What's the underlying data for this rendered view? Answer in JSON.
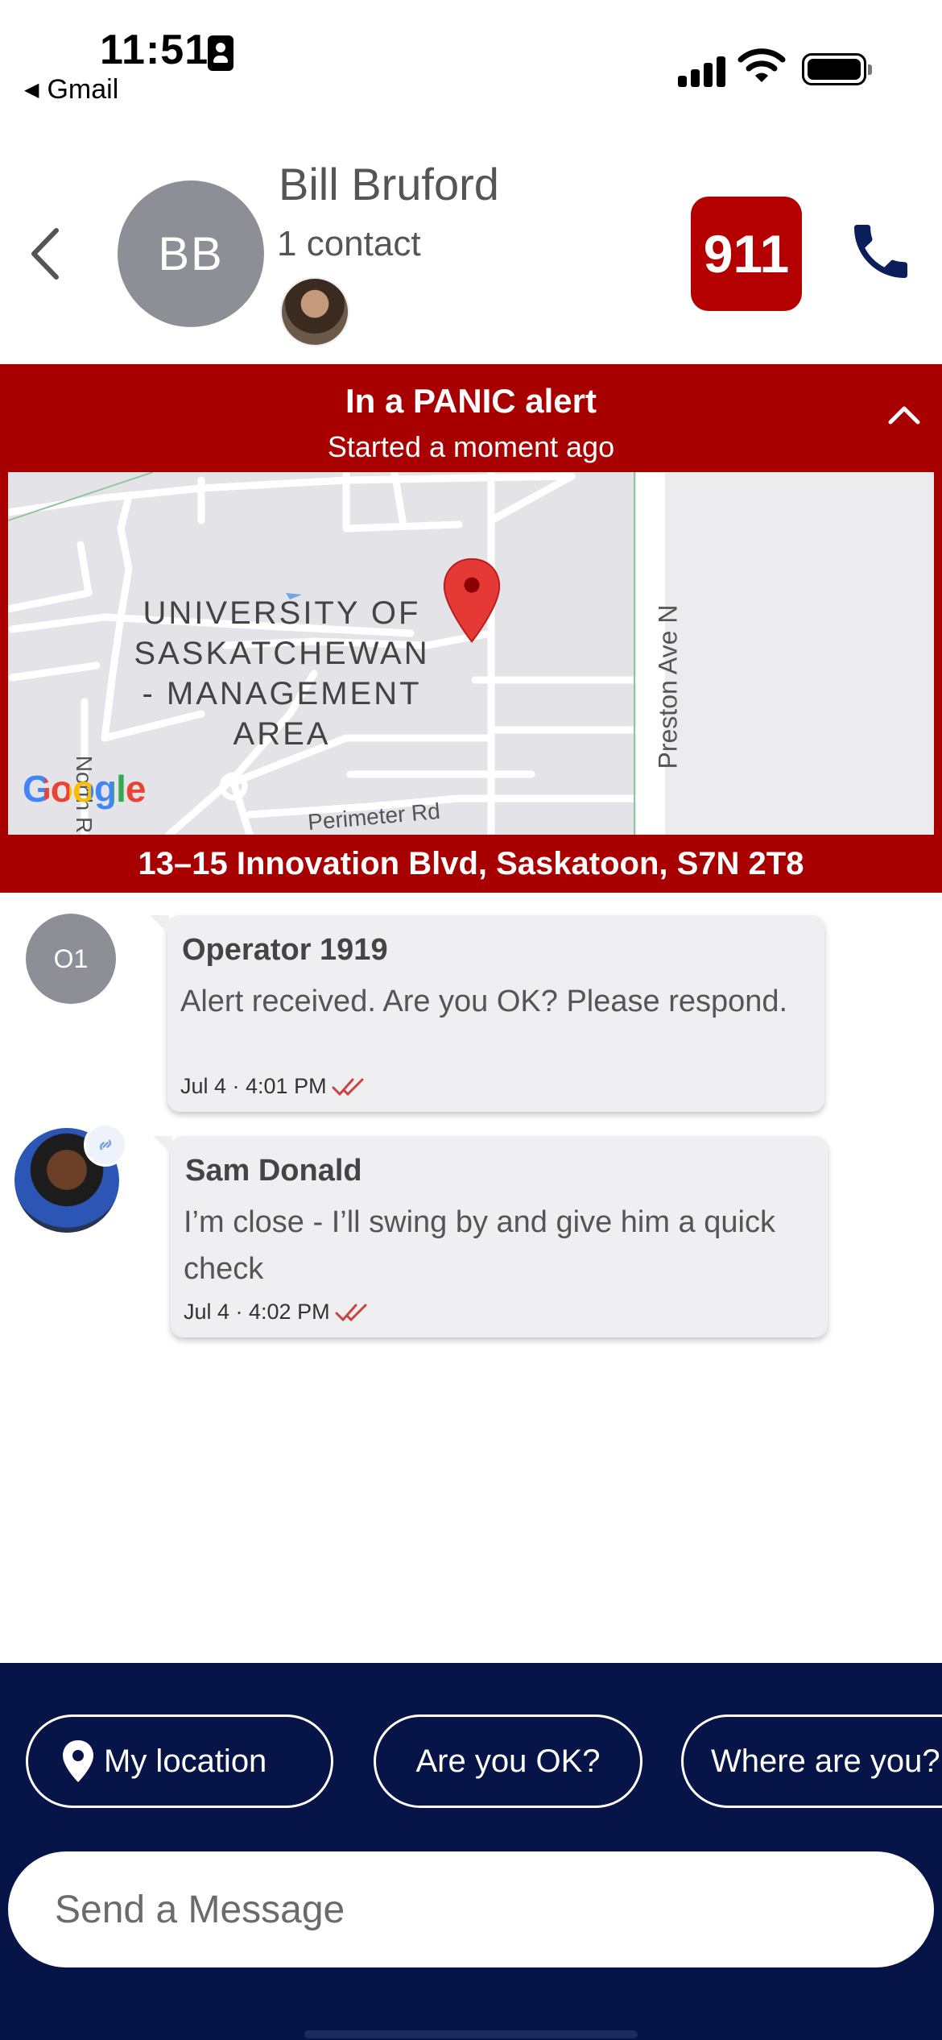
{
  "status_bar": {
    "time": "11:51",
    "back_app": "Gmail",
    "icons": [
      "id-badge-icon",
      "cellular-signal-icon",
      "wifi-icon",
      "battery-icon"
    ]
  },
  "header": {
    "avatar_initials": "BB",
    "name": "Bill Bruford",
    "contacts_count": "1 contact",
    "emergency_button": "911",
    "icons": [
      "chevron-left-icon",
      "phone-icon"
    ]
  },
  "alert": {
    "title": "In a PANIC alert",
    "subtitle": "Started a moment ago",
    "address": "13–15 Innovation Blvd, Saskatoon, S7N 2T8",
    "icons": [
      "chevron-up-icon"
    ]
  },
  "map": {
    "area_label_lines": [
      "UNIVERSITY OF",
      "SASKATCHEWAN",
      "- MANAGEMENT",
      "AREA"
    ],
    "streets": [
      "Preston Ave N",
      "Perimeter Rd",
      "North R"
    ],
    "logo": "Google",
    "marker": "map-pin-icon"
  },
  "messages": [
    {
      "avatar": "O1",
      "sender": "Operator 1919",
      "text": "Alert received. Are you OK? Please respond.",
      "timestamp": "Jul 4 · 4:01 PM"
    },
    {
      "avatar": "photo",
      "sender": "Sam Donald",
      "text": "I’m close - I’ll swing by and give him a quick check",
      "timestamp": "Jul 4 · 4:02 PM"
    }
  ],
  "quick_replies": [
    "My location",
    "Are you OK?",
    "Where are you?"
  ],
  "composer": {
    "placeholder": "Send a Message"
  },
  "colors": {
    "alert_red": "#a80000",
    "button_red": "#b40000",
    "navy": "#061448",
    "tick_red": "#d04040",
    "avatar_gray": "#8e8f96"
  }
}
